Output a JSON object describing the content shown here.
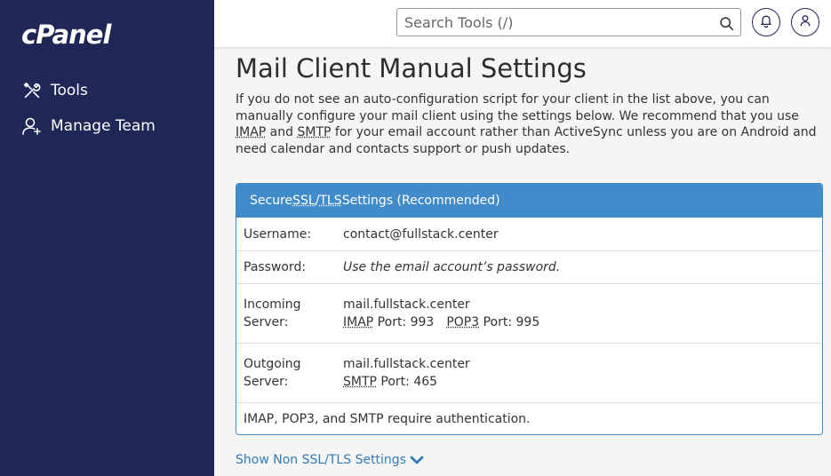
{
  "sidebar": {
    "logo": "cPanel",
    "items": [
      {
        "label": "Tools",
        "icon": "tools-icon"
      },
      {
        "label": "Manage Team",
        "icon": "manage-team-icon"
      }
    ]
  },
  "header": {
    "search_placeholder": "Search Tools (/)"
  },
  "main": {
    "title": "Mail Client Manual Settings",
    "intro": {
      "p1": "If you do not see an auto-configuration script for your client in the list above, you can manually configure your mail client using the settings below. We recommend that you use ",
      "imap": "IMAP",
      "and": " and ",
      "smtp": "SMTP",
      "p2": " for your email account rather than ActiveSync unless you are on Android and need calendar and contacts support or push updates."
    },
    "panel": {
      "title_pre": "Secure ",
      "ssl": "SSL",
      "slash": "/",
      "tls": "TLS",
      "title_post": " Settings (Recommended)",
      "username_label": "Username:",
      "username_value": "contact@fullstack.center",
      "password_label": "Password:",
      "password_value": "Use the email account’s password.",
      "incoming_label_1": "Incoming",
      "incoming_label_2": "Server:",
      "incoming_host": "mail.fullstack.center",
      "imap_abbr": "IMAP",
      "imap_port_text": " Port: 993",
      "pop3_abbr": "POP3",
      "pop3_port_text": " Port: 995",
      "outgoing_label_1": "Outgoing",
      "outgoing_label_2": "Server:",
      "outgoing_host": "mail.fullstack.center",
      "smtp_abbr": "SMTP",
      "smtp_port_text": " Port: 465",
      "auth_note": "IMAP, POP3, and SMTP require authentication."
    },
    "toggle_label": "Show Non SSL/TLS Settings"
  },
  "colors": {
    "sidebar_bg": "#1e2756",
    "panel_accent": "#428bca",
    "link": "#337ab7"
  }
}
